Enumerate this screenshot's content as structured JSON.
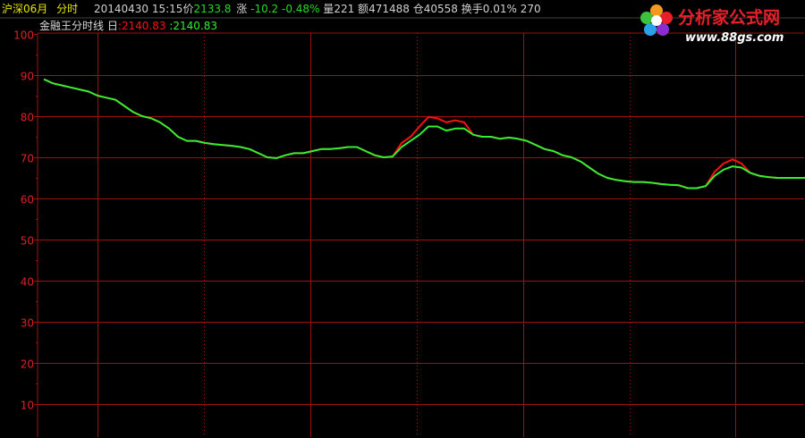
{
  "header": {
    "symbol": "沪深06月",
    "period": "分时",
    "datetime": "20140430 15:15",
    "price_label": "价",
    "price": "2133.8",
    "change_label": "涨",
    "change": "-10.2",
    "change_pct": "-0.48%",
    "volume_label": "量",
    "volume": "221",
    "amount_label": "额",
    "amount": "471488",
    "oi_label": "仓",
    "open_interest": "40558",
    "turnover_label": "换手",
    "turnover": "0.01%",
    "extra": "270"
  },
  "indicator": {
    "name": "金融王分时线",
    "day_label": "日",
    "value_red": ":2140.83",
    "value_green": ":2140.83"
  },
  "logo": {
    "title": "分析家公式网",
    "url": "www.88gs.com"
  },
  "colors": {
    "grid": "#a01010",
    "axis_text": "#e02020",
    "line_green": "#33ee33",
    "line_red": "#ff1010",
    "header_yellow": "#e6e600",
    "header_green": "#22dd22",
    "logo_red": "#e8202a",
    "logo_text": "#ffffff"
  },
  "chart_data": {
    "type": "line",
    "ylim": [
      5,
      100
    ],
    "yticks": [
      10,
      20,
      30,
      40,
      50,
      60,
      70,
      80,
      90,
      100
    ],
    "x": [
      0,
      10,
      20,
      30,
      40,
      50,
      60,
      70,
      80,
      90,
      100,
      110,
      120,
      130,
      140,
      150,
      160,
      170,
      180,
      190,
      200,
      210,
      220,
      230,
      240,
      250,
      260,
      270,
      280,
      290,
      300,
      310,
      320,
      330,
      340,
      350,
      360,
      370,
      380,
      390,
      400,
      410,
      420,
      430,
      440,
      450,
      460,
      470,
      480,
      490,
      500,
      510,
      520,
      530,
      540,
      550,
      560,
      570,
      580,
      590,
      600,
      610,
      620,
      630,
      640,
      650,
      660,
      670,
      680,
      690,
      700,
      710,
      720,
      730,
      740,
      750,
      760,
      770,
      780,
      790,
      800,
      810,
      820,
      830,
      840,
      850,
      860
    ],
    "series": [
      {
        "values": [
          89,
          88,
          87.5,
          87,
          86.5,
          86,
          85,
          84.5,
          84,
          82.5,
          81,
          80,
          79.5,
          78.5,
          77,
          75,
          74,
          74,
          73.5,
          73.2,
          73,
          72.8,
          72.5,
          72,
          71,
          70,
          69.8,
          70.5,
          71,
          71,
          71.5,
          72,
          72,
          72.2,
          72.5,
          72.5,
          71.5,
          70.5,
          70,
          70.2,
          72.5,
          74,
          75.5,
          77.5,
          77.5,
          76.5,
          77,
          77,
          75.5,
          75,
          75,
          74.5,
          74.8,
          74.5,
          74,
          73,
          72,
          71.5,
          70.5,
          70,
          69,
          67.5,
          66,
          65,
          64.5,
          64.2,
          64,
          64,
          63.8,
          63.5,
          63.3,
          63.2,
          62.5,
          62.5,
          63,
          65.5,
          67,
          67.8,
          67.5,
          66.2,
          65.5,
          65.2,
          65,
          65,
          65,
          65,
          65.5
        ]
      },
      {
        "values": [
          89,
          88,
          87.5,
          87,
          86.5,
          86,
          85,
          84.5,
          84,
          82.5,
          81,
          80,
          79.5,
          78.5,
          77,
          75,
          74,
          74,
          73.5,
          73.2,
          73,
          72.8,
          72.5,
          72,
          71,
          70,
          69.8,
          70.5,
          71,
          71,
          71.5,
          72,
          72,
          72.2,
          72.5,
          72.5,
          71.5,
          70.5,
          70,
          70.2,
          73.5,
          75,
          77.5,
          79.8,
          79.5,
          78.5,
          79,
          78.5,
          75.5,
          75,
          75,
          74.5,
          74.8,
          74.5,
          74,
          73,
          72,
          71.5,
          70.5,
          70,
          69,
          67.5,
          66,
          65,
          64.5,
          64.2,
          64,
          64,
          63.8,
          63.5,
          63.3,
          63.2,
          62.5,
          62.5,
          63,
          66.5,
          68.5,
          69.5,
          68.5,
          66.2,
          65.5,
          65.2,
          65,
          65,
          65,
          65,
          65.5
        ]
      }
    ]
  }
}
